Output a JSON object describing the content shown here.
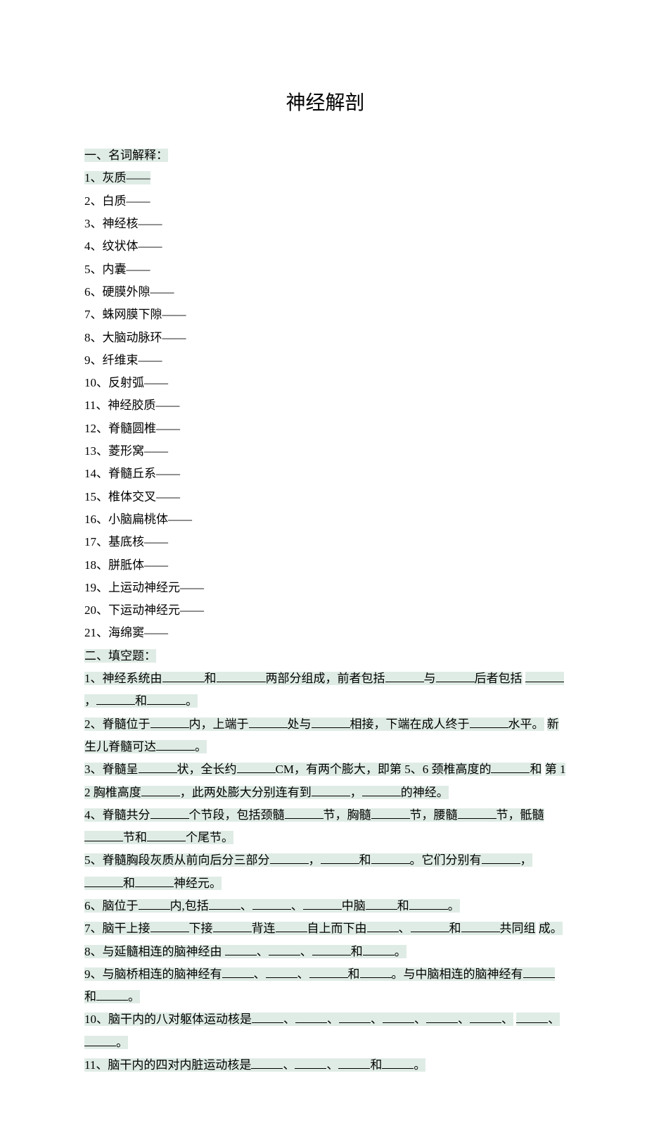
{
  "title": "神经解剖",
  "section1": {
    "heading": "一、名词解释：",
    "items": [
      "1、灰质——",
      "2、白质——",
      "3、神经核——",
      "4、纹状体——",
      "5、内囊——",
      "6、硬膜外隙——",
      "7、蛛网膜下隙——",
      "8、大脑动脉环——",
      "9、纤维束——",
      "10、反射弧——",
      "11、神经胶质——",
      "12、脊髓圆椎——",
      "13、菱形窝——",
      "14、脊髓丘系——",
      "15、椎体交叉——",
      "16、小脑扁桃体——",
      "17、基底核——",
      "18、胼胝体——",
      "19、上运动神经元——",
      "20、下运动神经元——",
      "21、海绵窦——"
    ]
  },
  "section2": {
    "heading": "二、填空题：",
    "q1a": "1、神经系统由",
    "q1b": "和",
    "q1c": "两部分组成，前者包括",
    "q1d": "与",
    "q1e": "后者包括",
    "q1f": "，",
    "q1g": "和",
    "q1h": "。",
    "q2a": "2、脊髓位于",
    "q2b": "内，上端于",
    "q2c": "处与",
    "q2d": "相接，下端在成人终于",
    "q2e": "水平。",
    "q2f": "新生儿脊髓可达",
    "q2g": "。",
    "q3a": "3、脊髓呈",
    "q3b": "状，全长约",
    "q3c": "CM，有两个膨大，即第 5、6 颈椎高度的",
    "q3d": "和",
    "q3e": "第 12 胸椎高度",
    "q3f": "，此两处膨大分别连有到",
    "q3g": "，",
    "q3h": "的神经。",
    "q4a": "4、脊髓共分",
    "q4b": "个节段，包括颈髓",
    "q4c": "节，胸髓",
    "q4d": "节，腰髓",
    "q4e": "节，骶髓",
    "q4f": "节和",
    "q4g": "个尾节。",
    "q5a": "5、脊髓胸段灰质从前向后分三部分",
    "q5b": "，",
    "q5c": "和",
    "q5d": "。它们分别有",
    "q5e": "，",
    "q5f": "和",
    "q5g": "神经元。",
    "q6a": "6、脑位于",
    "q6b": "内,包括",
    "q6c": "、",
    "q6d": "、",
    "q6e": "中脑",
    "q6f": "和",
    "q6g": "。",
    "q7a": "7、脑干上接",
    "q7b": "下接",
    "q7c": "背连",
    "q7d": "自上而下由",
    "q7e": "、",
    "q7f": "和",
    "q7g": "共同组",
    "q7h": "成。",
    "q8a": "8、与延髓相连的脑神经由",
    "q8b": "、",
    "q8c": "、",
    "q8d": "和",
    "q8e": "。",
    "q9a": "9、与脑桥相连的脑神经有",
    "q9b": "、",
    "q9c": "、",
    "q9d": "和",
    "q9e": "。与中脑相连的脑神经有",
    "q9f": "和",
    "q9g": "。",
    "q10a": "10、脑干内的八对躯体运动核是",
    "q10b": "、",
    "q10c": "、",
    "q10d": "、",
    "q10e": "、",
    "q10f": "、",
    "q10g": "、",
    "q10h": "、",
    "q10i": "。",
    "q11a": "11、脑干内的四对内脏运动核是",
    "q11b": "、",
    "q11c": "、",
    "q11d": "和",
    "q11e": "。"
  }
}
